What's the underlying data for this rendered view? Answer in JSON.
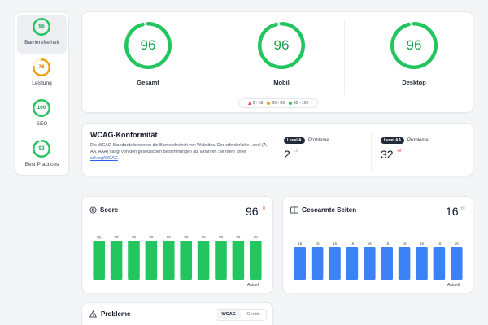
{
  "sidebar": {
    "items": [
      {
        "label": "Barrierefreiheit",
        "score": "96",
        "fraction": 0.96,
        "color": "#22c55e",
        "text_color": "#16a34a",
        "active": true
      },
      {
        "label": "Leistung",
        "score": "76",
        "fraction": 0.76,
        "color": "#f59e0b",
        "text_color": "#d97706",
        "active": false
      },
      {
        "label": "SEO",
        "score": "100",
        "fraction": 1.0,
        "color": "#22c55e",
        "text_color": "#16a34a",
        "active": false
      },
      {
        "label": "Best Practices",
        "score": "93",
        "fraction": 0.93,
        "color": "#22c55e",
        "text_color": "#16a34a",
        "active": false
      }
    ]
  },
  "scores": [
    {
      "label": "Gesamt",
      "value": "96",
      "fraction": 0.96
    },
    {
      "label": "Mobil",
      "value": "96",
      "fraction": 0.96
    },
    {
      "label": "Desktop",
      "value": "96",
      "fraction": 0.96
    }
  ],
  "legend": [
    {
      "label": "0 - 59",
      "shape": "triangle",
      "color": "#ef4444"
    },
    {
      "label": "60 - 89",
      "shape": "circle",
      "color": "#f59e0b"
    },
    {
      "label": "90 - 100",
      "shape": "circle",
      "color": "#22c55e"
    }
  ],
  "wcag": {
    "title": "WCAG-Konformität",
    "description": "Die WCAG-Standards bewerten die Barrierefreiheit von Websites. Der erforderliche Level (A, AA, AAA) hängt von den gesetzlichen Bestimmungen ab. Erfahren Sie mehr unter ",
    "link": "w3.org/WCAG",
    "levels": [
      {
        "badge": "Level A",
        "label": "Probleme",
        "count": "2",
        "delta": "±0",
        "delta_color": "#9ca3af"
      },
      {
        "badge": "Level AA",
        "label": "Probleme",
        "count": "32",
        "delta": "+2",
        "delta_color": "#ef4444"
      }
    ]
  },
  "score_chart": {
    "title": "Score",
    "icon": "target-icon",
    "current": "96",
    "delta": "0",
    "delta_color": "#ef4444",
    "aktuell": "Aktuell"
  },
  "pages_chart": {
    "title": "Gescannte Seiten",
    "icon": "pages-icon",
    "current": "16",
    "delta": "±0",
    "delta_color": "#9ca3af",
    "aktuell": "Aktuell"
  },
  "chart_data": [
    {
      "type": "bar",
      "title": "Score",
      "values": [
        95,
        96,
        96,
        96,
        96,
        96,
        96,
        96,
        96,
        96
      ],
      "ylim": [
        0,
        100
      ],
      "color": "#22c55e",
      "grid": false
    },
    {
      "type": "bar",
      "title": "Gescannte Seiten",
      "values": [
        16,
        16,
        16,
        16,
        16,
        16,
        16,
        16,
        16,
        16
      ],
      "ylim": [
        0,
        20
      ],
      "color": "#3b82f6",
      "grid": false
    }
  ],
  "probleme": {
    "title": "Probleme",
    "icon": "warning-icon",
    "tabs": [
      "WCAG",
      "Geräte"
    ]
  }
}
